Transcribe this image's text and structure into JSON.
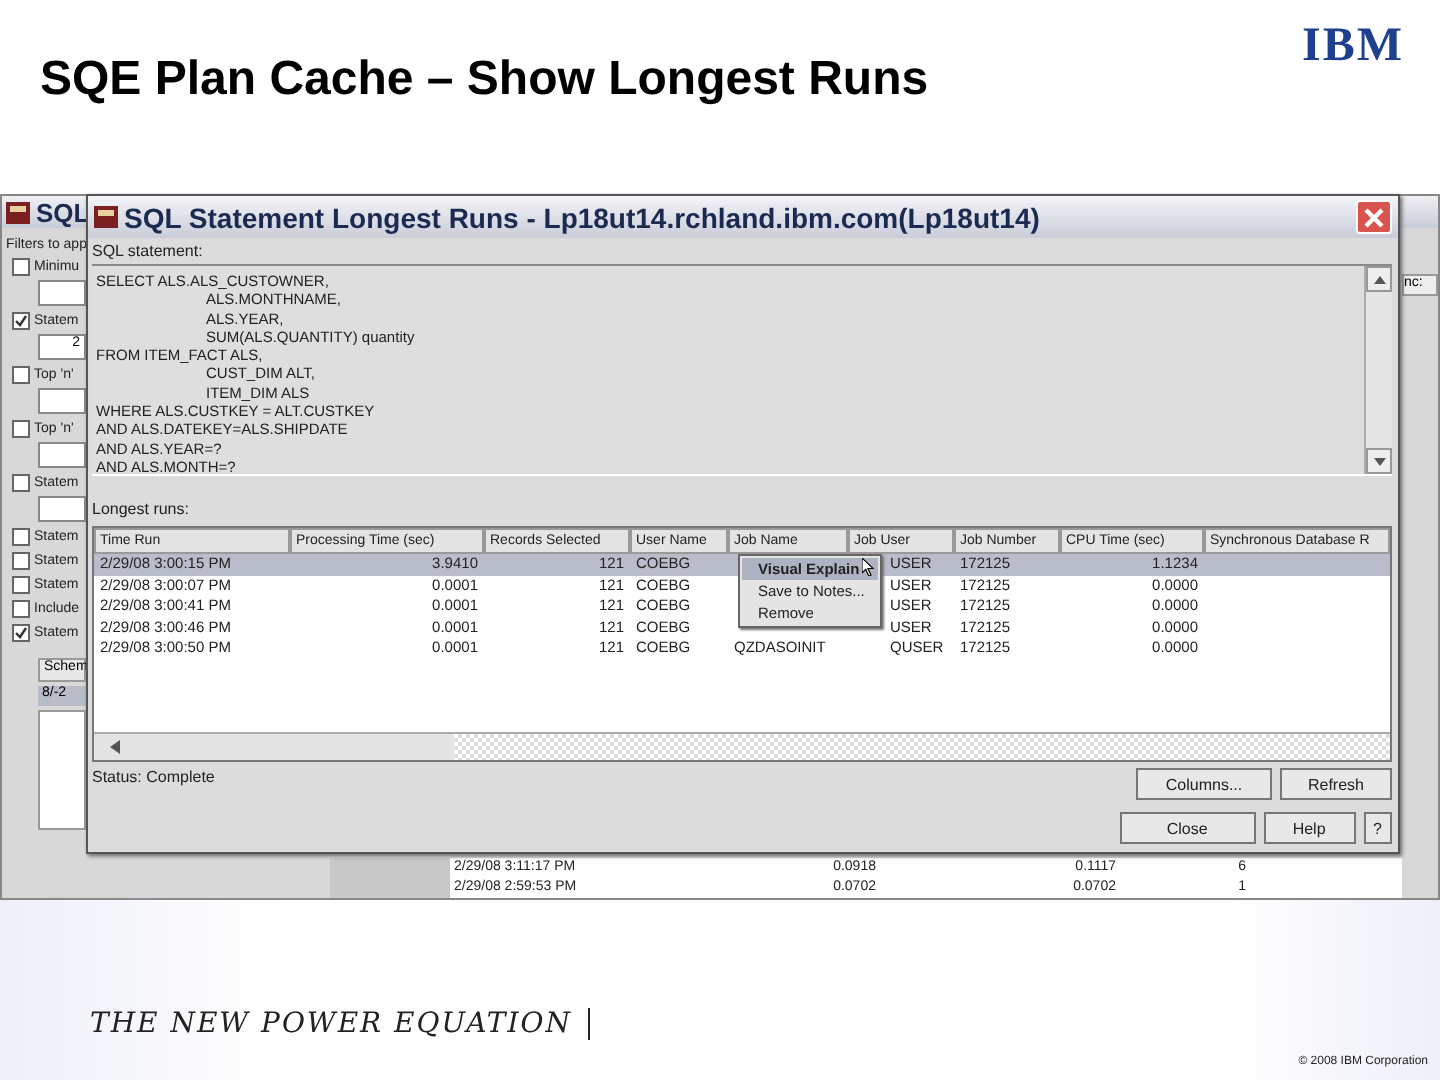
{
  "slide": {
    "title": "SQE Plan Cache – Show Longest Runs",
    "logo": "IBM",
    "tagline": "THE NEW POWER EQUATION",
    "copyright": "© 2008 IBM Corporation"
  },
  "background_window": {
    "title": "SQL",
    "filters_label": "Filters to app",
    "filters": [
      {
        "label": "Minimu",
        "checked": false,
        "kind": "field"
      },
      {
        "label": "Statem",
        "checked": true,
        "kind": "field",
        "value": "2"
      },
      {
        "label": "Top 'n'",
        "checked": false,
        "kind": "field"
      },
      {
        "label": "Top 'n'",
        "checked": false,
        "kind": "field"
      },
      {
        "label": "Statem",
        "checked": false,
        "kind": "field"
      },
      {
        "label": "Statem",
        "checked": false,
        "kind": "plain"
      },
      {
        "label": "Statem",
        "checked": false,
        "kind": "plain"
      },
      {
        "label": "Statem",
        "checked": false,
        "kind": "plain"
      },
      {
        "label": "Include",
        "checked": false,
        "kind": "plain"
      },
      {
        "label": "Statem",
        "checked": true,
        "kind": "plain"
      }
    ],
    "schema_header": "Schem",
    "schema_row": "8/-2",
    "right_header": "nc:",
    "rows": [
      [
        "2/29/08 3:11:17 PM",
        "0.0918",
        "0.1117",
        "6"
      ],
      [
        "2/29/08 2:59:53 PM",
        "0.0702",
        "0.0702",
        "1"
      ]
    ]
  },
  "dialog": {
    "title": "SQL Statement Longest Runs - Lp18ut14.rchland.ibm.com(Lp18ut14)",
    "sql_label": "SQL statement:",
    "sql_lines": [
      {
        "text": "SELECT ALS.ALS_CUSTOWNER,",
        "indent": false
      },
      {
        "text": "ALS.MONTHNAME,",
        "indent": true
      },
      {
        "text": "ALS.YEAR,",
        "indent": true
      },
      {
        "text": "SUM(ALS.QUANTITY) quantity",
        "indent": true
      },
      {
        "text": "FROM ITEM_FACT ALS,",
        "indent": false
      },
      {
        "text": "CUST_DIM ALT,",
        "indent": true
      },
      {
        "text": "ITEM_DIM ALS",
        "indent": true
      },
      {
        "text": "WHERE ALS.CUSTKEY = ALT.CUSTKEY",
        "indent": false
      },
      {
        "text": "AND ALS.DATEKEY=ALS.SHIPDATE",
        "indent": false
      },
      {
        "text": "AND ALS.YEAR=?",
        "indent": false
      },
      {
        "text": "AND ALS.MONTH=?",
        "indent": false
      }
    ],
    "table_label": "Longest runs:",
    "columns": [
      "Time Run",
      "Processing Time (sec)",
      "Records Selected",
      "User Name",
      "Job Name",
      "Job User",
      "Job Number",
      "CPU Time (sec)",
      "Synchronous Database R"
    ],
    "rows": [
      {
        "selected": true,
        "cells": [
          "2/29/08 3:00:15 PM",
          "3.9410",
          "121",
          "COEBG",
          null,
          "USER",
          "172125",
          "1.1234",
          null
        ]
      },
      {
        "selected": false,
        "cells": [
          "2/29/08 3:00:07 PM",
          "0.0001",
          "121",
          "COEBG",
          null,
          "USER",
          "172125",
          "0.0000",
          null
        ]
      },
      {
        "selected": false,
        "cells": [
          "2/29/08 3:00:41 PM",
          "0.0001",
          "121",
          "COEBG",
          null,
          "USER",
          "172125",
          "0.0000",
          null
        ]
      },
      {
        "selected": false,
        "cells": [
          "2/29/08 3:00:46 PM",
          "0.0001",
          "121",
          "COEBG",
          null,
          "USER",
          "172125",
          "0.0000",
          null
        ]
      },
      {
        "selected": false,
        "cells": [
          "2/29/08 3:00:50 PM",
          "0.0001",
          "121",
          "COEBG",
          "QZDASOINIT",
          "QUSER",
          "172125",
          "0.0000",
          null
        ]
      }
    ],
    "context_menu": [
      {
        "label": "Visual Explain",
        "selected": true
      },
      {
        "label": "Save to Notes...",
        "selected": false
      },
      {
        "label": "Remove",
        "selected": false
      }
    ],
    "status": "Status: Complete",
    "buttons": [
      "Columns...",
      "Refresh"
    ],
    "bottom_buttons": [
      "Close",
      "Help",
      "?"
    ]
  }
}
